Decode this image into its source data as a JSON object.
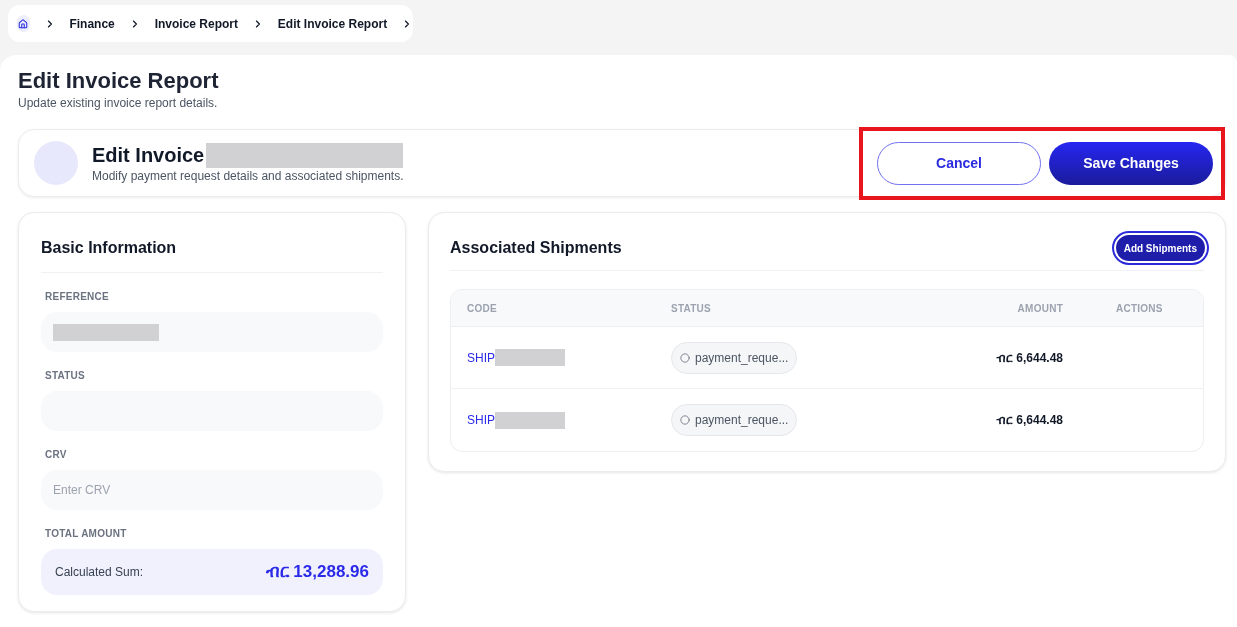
{
  "breadcrumb": {
    "items": [
      {
        "label": "Finance"
      },
      {
        "label": "Invoice Report"
      },
      {
        "label": "Edit Invoice Report"
      }
    ]
  },
  "page": {
    "title": "Edit Invoice Report",
    "subtitle": "Update existing invoice report details."
  },
  "header_card": {
    "title": "Edit Invoice",
    "title_redacted": true,
    "subtitle": "Modify payment request details and associated shipments.",
    "highlighted": true,
    "buttons": [
      {
        "label": "Cancel",
        "kind": "outline"
      },
      {
        "label": "Save Changes",
        "kind": "primary"
      }
    ]
  },
  "basic_information": {
    "title": "Basic Information",
    "fields": [
      {
        "label": "REFERENCE",
        "redacted": true
      },
      {
        "label": "STATUS",
        "redacted": false
      },
      {
        "label": "CRV",
        "redacted": false,
        "placeholder": "Enter CRV"
      }
    ],
    "total": {
      "label": "TOTAL AMOUNT",
      "caption": "Calculated Sum:",
      "amount": "ብር 13,288.96"
    }
  },
  "shipments": {
    "title": "Associated Shipments",
    "add_button": "Add Shipments",
    "columns": [
      "CODE",
      "STATUS",
      "AMOUNT",
      "ACTIONS"
    ],
    "rows": [
      {
        "code": "SHIP",
        "code_redacted": true,
        "status": "payment_reque...",
        "amount": "ብር 6,644.48"
      },
      {
        "code": "SHIP",
        "code_redacted": true,
        "status": "payment_reque...",
        "amount": "ብር 6,644.48"
      }
    ]
  }
}
